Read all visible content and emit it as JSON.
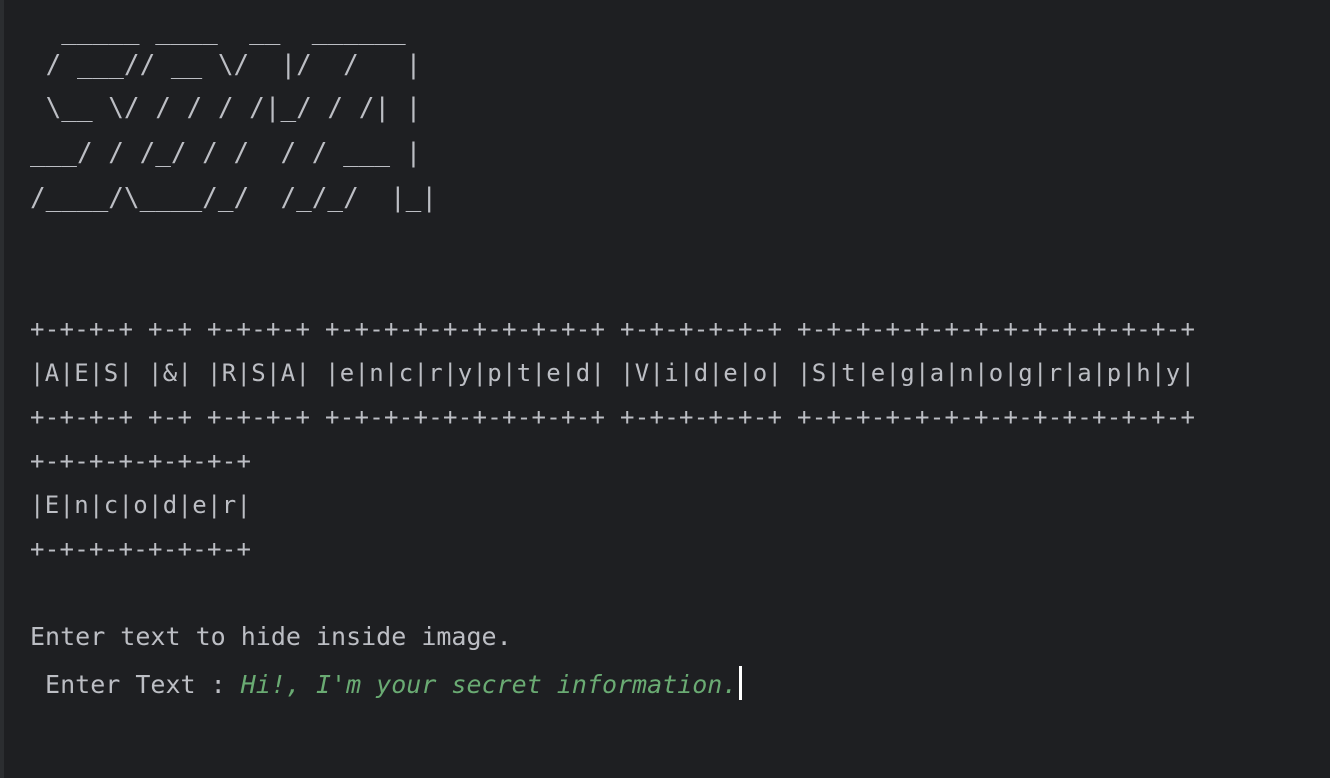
{
  "banner": {
    "lines": [
      "  _____ ____  __  ______",
      " / ___// __ \\/  |/  /   |",
      " \\__ \\/ / / / /|_/ / /| |",
      "___/ / /_/ / /  / / ___ |",
      "/____/\\____/_/  /_/_/  |_|"
    ]
  },
  "title_box": {
    "border": "+-+-+-+ +-+ +-+-+-+ +-+-+-+-+-+-+-+-+-+ +-+-+-+-+-+ +-+-+-+-+-+-+-+-+-+-+-+-+-+",
    "text": "|A|E|S| |&| |R|S|A| |e|n|c|r|y|p|t|e|d| |V|i|d|e|o| |S|t|e|g|a|n|o|g|r|a|p|h|y|"
  },
  "mode_box": {
    "border": "+-+-+-+-+-+-+-+",
    "text": "|E|n|c|o|d|e|r|"
  },
  "prompt": {
    "instruction": "Enter text to hide inside image.",
    "label": " Enter Text : ",
    "value": "Hi!, I'm your secret information."
  },
  "colors": {
    "background": "#1e1f22",
    "text": "#bcbec4",
    "input": "#6aab73"
  }
}
